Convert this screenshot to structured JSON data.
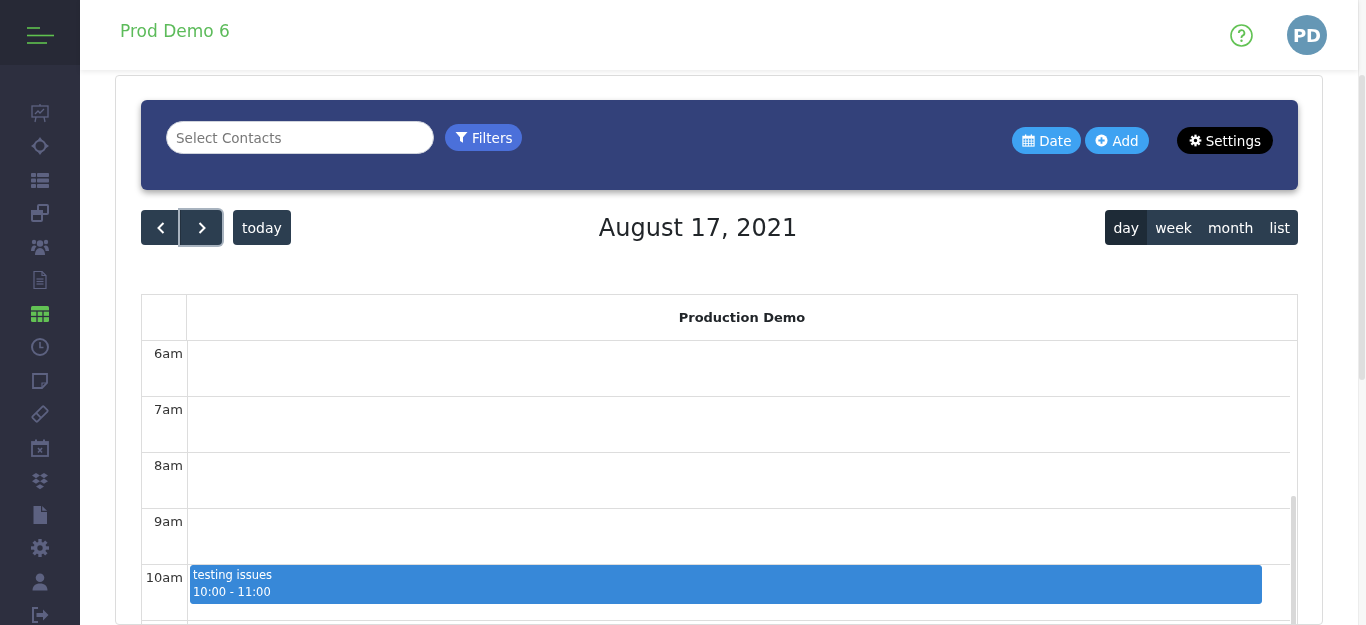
{
  "sidebar": {
    "items": [
      {
        "selected": false
      },
      {
        "selected": false
      },
      {
        "selected": false
      },
      {
        "selected": false
      },
      {
        "selected": false
      },
      {
        "selected": false
      },
      {
        "selected": true
      },
      {
        "selected": false
      },
      {
        "selected": false
      },
      {
        "selected": false
      },
      {
        "selected": false
      },
      {
        "selected": false
      },
      {
        "selected": false
      },
      {
        "selected": false
      },
      {
        "selected": false
      },
      {
        "selected": false
      }
    ]
  },
  "header": {
    "title": "Prod Demo 6",
    "avatar": "PD"
  },
  "toolbar": {
    "search": {
      "placeholder": "Select Contacts"
    },
    "filter_button": {
      "label": "Filters"
    },
    "actions": [
      {
        "label": "Date",
        "kind": "date"
      },
      {
        "label": "Add",
        "kind": "add"
      },
      {
        "label": "Settings",
        "kind": "settings"
      }
    ]
  },
  "calendar": {
    "nav": [
      {
        "kind": "prev",
        "focused": false
      },
      {
        "kind": "next",
        "focused": true
      }
    ],
    "today_button": "today",
    "title": "August 17, 2021",
    "views": [
      {
        "label": "day",
        "selected": true
      },
      {
        "label": "week",
        "selected": false
      },
      {
        "label": "month",
        "selected": false
      },
      {
        "label": "list",
        "selected": false
      }
    ],
    "resource": "Production Demo",
    "slots": [
      {
        "time": "6am"
      },
      {
        "time": "7am"
      },
      {
        "time": "8am"
      },
      {
        "time": "9am"
      },
      {
        "time": "10am",
        "events": [
          {
            "title": "testing issues",
            "time": "10:00 - 11:00"
          }
        ]
      }
    ]
  }
}
